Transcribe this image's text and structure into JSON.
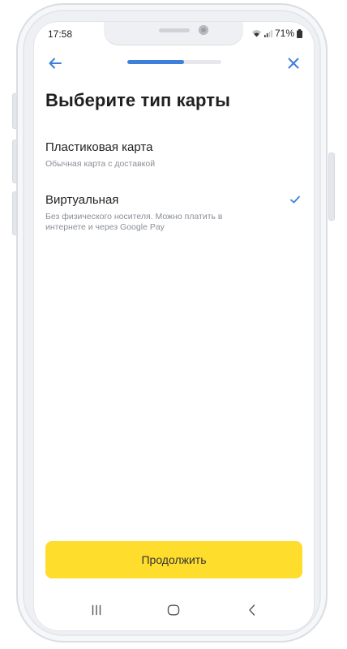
{
  "status_bar": {
    "time": "17:58",
    "battery": "71%",
    "icons": [
      "wifi-icon",
      "signal-icon",
      "battery-icon"
    ]
  },
  "header": {
    "back_icon": "arrow-left-icon",
    "close_icon": "close-icon",
    "progress": 0.6
  },
  "title": "Выберите тип карты",
  "options": [
    {
      "title": "Пластиковая карта",
      "subtitle": "Обычная карта с доставкой",
      "selected": false
    },
    {
      "title": "Виртуальная",
      "subtitle": "Без физического носителя. Можно платить в интернете и через Google Pay",
      "selected": true
    }
  ],
  "continue_label": "Продолжить",
  "nav_bar": {
    "icons": [
      "recent-apps-icon",
      "home-icon",
      "back-icon"
    ]
  },
  "colors": {
    "accent_blue": "#3d7fd9",
    "button_yellow": "#ffdd2d",
    "title_text": "#1f1f1f",
    "subtitle_text": "#8a8f96"
  }
}
